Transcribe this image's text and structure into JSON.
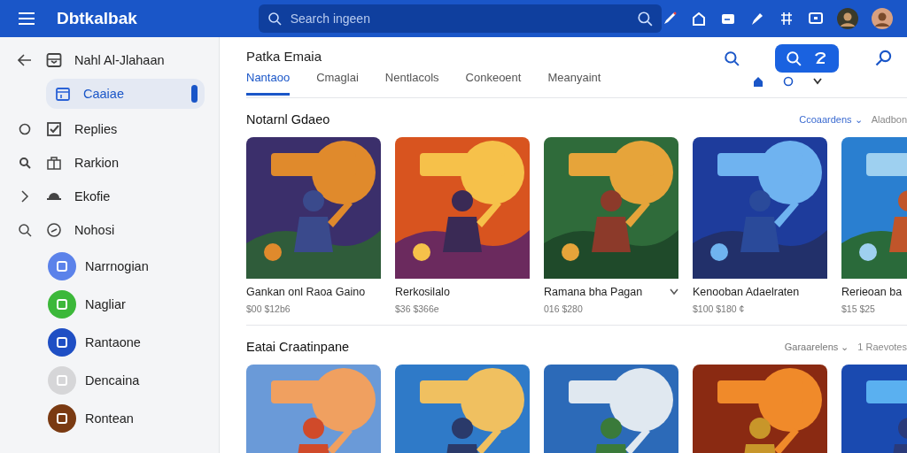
{
  "topbar": {
    "logo": "Dbtkalbak",
    "search": {
      "placeholder": "Search ingeen"
    }
  },
  "sidebar": {
    "items": [
      {
        "kind": "back",
        "label": "Nahl Al-Jlahaan",
        "selected": false
      },
      {
        "kind": "nav",
        "label": "Caaiae",
        "selected": true
      },
      {
        "kind": "nav",
        "label": "Replies",
        "selected": false
      },
      {
        "kind": "nav",
        "label": "Rarkion",
        "selected": false
      },
      {
        "kind": "nav",
        "label": "Ekofie",
        "selected": false
      },
      {
        "kind": "nav",
        "label": "Nohosi",
        "selected": false
      },
      {
        "kind": "app",
        "label": "Narrnogian",
        "selected": false,
        "color": "#5b82ea"
      },
      {
        "kind": "app",
        "label": "Nagliar",
        "selected": false,
        "color": "#3cb83a"
      },
      {
        "kind": "app",
        "label": "Rantaone",
        "selected": false,
        "color": "#1f4fc4"
      },
      {
        "kind": "app",
        "label": "Dencaina",
        "selected": false,
        "color": "#d6d6d8"
      },
      {
        "kind": "app",
        "label": "Rontean",
        "selected": false,
        "color": "#7a3a12"
      }
    ]
  },
  "header": {
    "title": "Patka Emaia",
    "tabs": [
      {
        "label": "Nantaoo",
        "selected": true
      },
      {
        "label": "Cmaglai",
        "selected": false
      },
      {
        "label": "Nentlacols",
        "selected": false
      },
      {
        "label": "Conkeoent",
        "selected": false
      },
      {
        "label": "Meanyaint",
        "selected": false
      }
    ]
  },
  "sections": [
    {
      "title": "Notarnl Gdaeo",
      "filter": "Ccoaardens ⌄",
      "link": "Aladbon",
      "cards": [
        {
          "kind": "picture",
          "title": "Gankan onl Raoa Gaino",
          "sub": "$00 $12b6",
          "menu": false
        },
        {
          "kind": "picture",
          "title": "Rerkosilalo",
          "sub": "$36 $366e",
          "menu": false
        },
        {
          "kind": "picture",
          "title": "Ramana bha Pagan",
          "sub": "016 $280",
          "menu": true
        },
        {
          "kind": "picture",
          "title": "Kenooban Adaelraten",
          "sub": "$100 $180 ¢",
          "menu": false
        },
        {
          "kind": "picture",
          "title": "Rerieoan ba",
          "sub": "$15 $25",
          "menu": false
        }
      ]
    },
    {
      "title": "Eatai Craatinpane",
      "filter": "Garaarelens ⌄",
      "link": "1 Raevotes"
    }
  ]
}
